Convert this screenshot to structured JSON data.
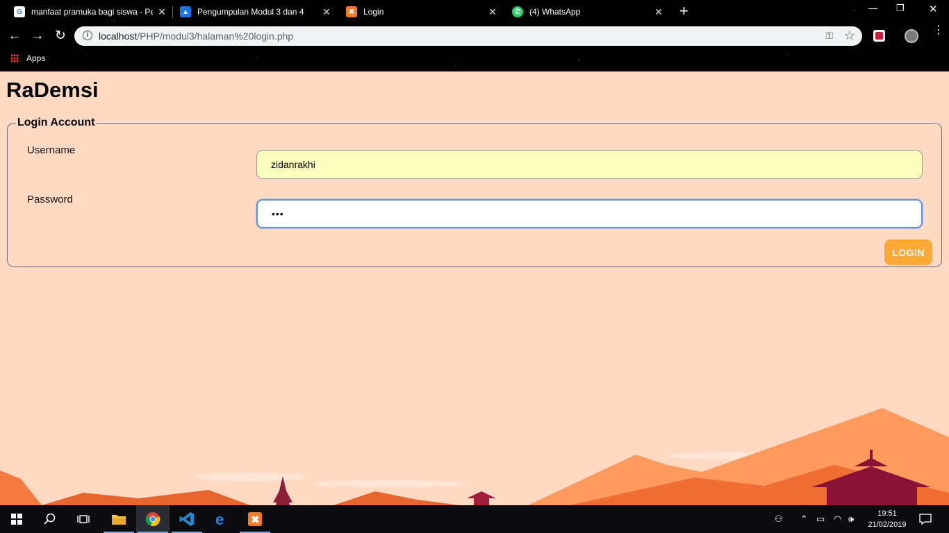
{
  "browser": {
    "tabs": [
      {
        "title": "manfaat pramuka bagi siswa - Pe",
        "icon": "google-icon"
      },
      {
        "title": "Pengumpulan Modul 3 dan 4",
        "icon": "classroom-icon"
      },
      {
        "title": "Login",
        "icon": "xampp-icon"
      },
      {
        "title": "(4) WhatsApp",
        "icon": "whatsapp-icon"
      }
    ],
    "url_host": "localhost",
    "url_path": "/PHP/modul3/halaman%20login.php",
    "bookmarks": {
      "apps_label": "Apps"
    }
  },
  "page": {
    "title": "RaDemsi",
    "form": {
      "legend": "Login Account",
      "username_label": "Username",
      "username_value": "zidanrakhi",
      "password_label": "Password",
      "password_value": "•••",
      "login_button": "LOGIN"
    }
  },
  "taskbar": {
    "time": "19:51",
    "date": "21/02/2019"
  },
  "colors": {
    "background": "#ffd9c2",
    "login_button": "#ffa835",
    "username_field": "#fbffbd"
  }
}
